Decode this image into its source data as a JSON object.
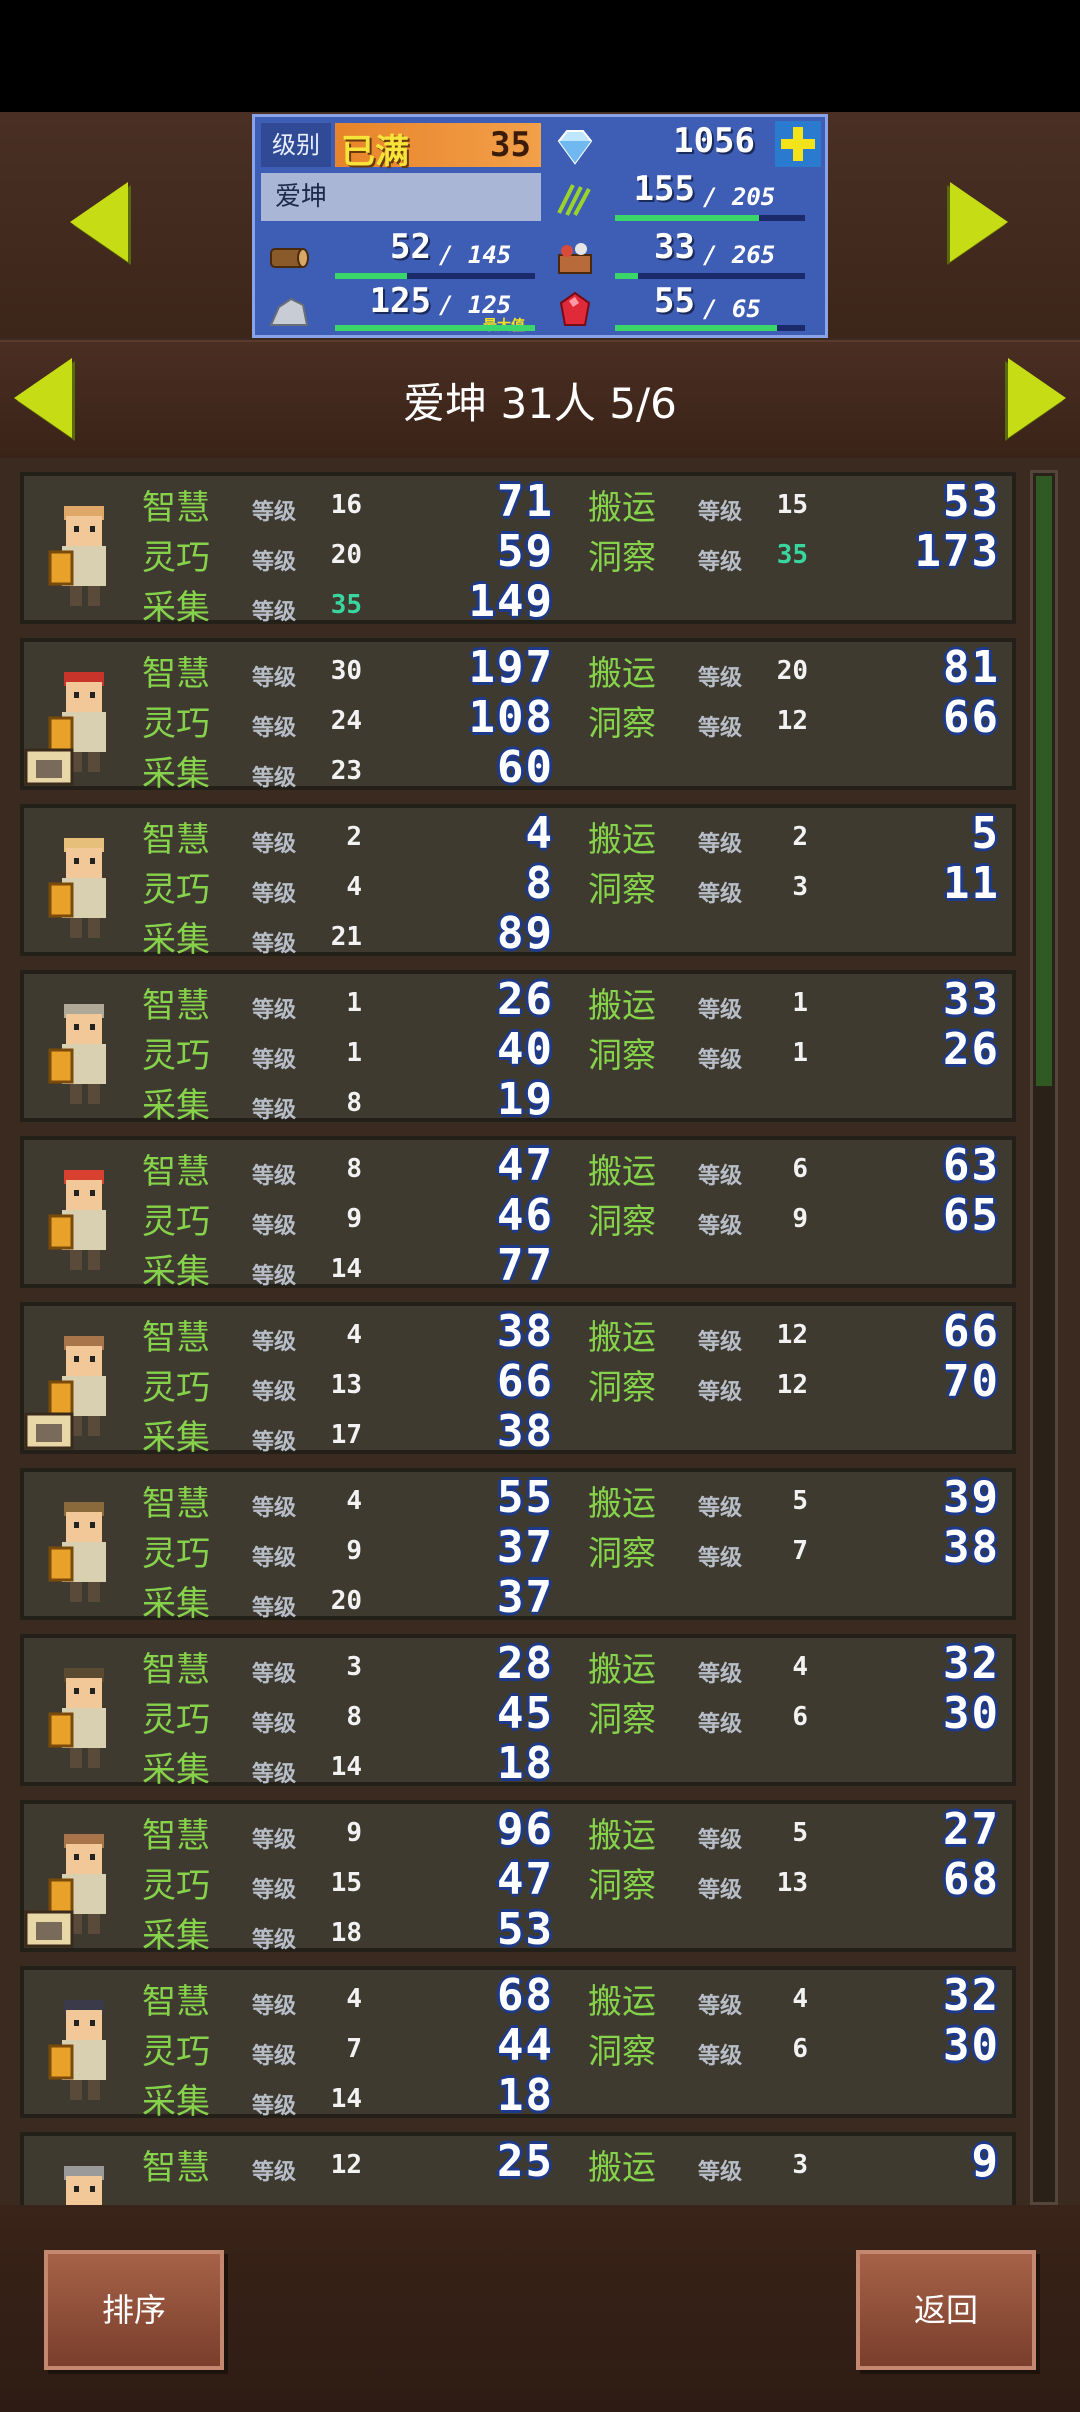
{
  "colors": {
    "accent_green": "#86d24a",
    "value_outline": "#1d3a8c",
    "panel_blue": "#3e5db4"
  },
  "status": {
    "rank_label": "级别",
    "rank_status": "已满",
    "rank_level": "35",
    "gems": "1056",
    "name": "爱坤",
    "resources": {
      "grass": {
        "value": "155",
        "max": "205",
        "icon": "grass-icon",
        "fill": 0.76
      },
      "wood": {
        "value": "52",
        "max": "145",
        "icon": "wood-log-icon",
        "fill": 0.36
      },
      "vegetables": {
        "value": "33",
        "max": "265",
        "icon": "vegetable-basket-icon",
        "fill": 0.12
      },
      "stone": {
        "value": "125",
        "max": "125",
        "max_label": "最大值",
        "icon": "stone-icon",
        "fill": 1.0
      },
      "ruby": {
        "value": "55",
        "max": "65",
        "icon": "ruby-icon",
        "fill": 0.85
      }
    }
  },
  "team": {
    "title": "爱坤  31人 5/6"
  },
  "labels": {
    "wisdom": "智慧",
    "dexterity": "灵巧",
    "gather": "采集",
    "carry": "搬运",
    "insight": "洞察",
    "level": "等级"
  },
  "members": [
    {
      "avatar": "blonde-worker-avatar",
      "wisdom": {
        "lv": "16",
        "val": "71"
      },
      "dexterity": {
        "lv": "20",
        "val": "59"
      },
      "gather": {
        "lv": "35",
        "val": "149",
        "hi": true
      },
      "carry": {
        "lv": "15",
        "val": "53"
      },
      "insight": {
        "lv": "35",
        "val": "173",
        "hi": true
      },
      "badge": null
    },
    {
      "avatar": "king-avatar",
      "wisdom": {
        "lv": "30",
        "val": "197"
      },
      "dexterity": {
        "lv": "24",
        "val": "108"
      },
      "gather": {
        "lv": "23",
        "val": "60"
      },
      "carry": {
        "lv": "20",
        "val": "81"
      },
      "insight": {
        "lv": "12",
        "val": "66"
      },
      "badge": "house-egg-icon"
    },
    {
      "avatar": "knight-avatar",
      "wisdom": {
        "lv": "2",
        "val": "4"
      },
      "dexterity": {
        "lv": "4",
        "val": "8"
      },
      "gather": {
        "lv": "21",
        "val": "89"
      },
      "carry": {
        "lv": "2",
        "val": "5"
      },
      "insight": {
        "lv": "3",
        "val": "11"
      },
      "badge": null
    },
    {
      "avatar": "hooded-worker-avatar",
      "wisdom": {
        "lv": "1",
        "val": "26"
      },
      "dexterity": {
        "lv": "1",
        "val": "40"
      },
      "gather": {
        "lv": "8",
        "val": "19"
      },
      "carry": {
        "lv": "1",
        "val": "33"
      },
      "insight": {
        "lv": "1",
        "val": "26"
      },
      "badge": null
    },
    {
      "avatar": "red-hat-worker-avatar",
      "wisdom": {
        "lv": "8",
        "val": "47"
      },
      "dexterity": {
        "lv": "9",
        "val": "46"
      },
      "gather": {
        "lv": "14",
        "val": "77"
      },
      "carry": {
        "lv": "6",
        "val": "63"
      },
      "insight": {
        "lv": "9",
        "val": "65"
      },
      "badge": null
    },
    {
      "avatar": "long-hair-worker-avatar",
      "wisdom": {
        "lv": "4",
        "val": "38"
      },
      "dexterity": {
        "lv": "13",
        "val": "66"
      },
      "gather": {
        "lv": "17",
        "val": "38"
      },
      "carry": {
        "lv": "12",
        "val": "66"
      },
      "insight": {
        "lv": "12",
        "val": "70"
      },
      "badge": "house-icon"
    },
    {
      "avatar": "brown-hair-worker-avatar",
      "wisdom": {
        "lv": "4",
        "val": "55"
      },
      "dexterity": {
        "lv": "9",
        "val": "37"
      },
      "gather": {
        "lv": "20",
        "val": "37"
      },
      "carry": {
        "lv": "5",
        "val": "39"
      },
      "insight": {
        "lv": "7",
        "val": "38"
      },
      "badge": null
    },
    {
      "avatar": "glasses-worker-avatar",
      "wisdom": {
        "lv": "3",
        "val": "28"
      },
      "dexterity": {
        "lv": "8",
        "val": "45"
      },
      "gather": {
        "lv": "14",
        "val": "18"
      },
      "carry": {
        "lv": "4",
        "val": "32"
      },
      "insight": {
        "lv": "6",
        "val": "30"
      },
      "badge": null
    },
    {
      "avatar": "ponytail-worker-avatar",
      "wisdom": {
        "lv": "9",
        "val": "96"
      },
      "dexterity": {
        "lv": "15",
        "val": "47"
      },
      "gather": {
        "lv": "18",
        "val": "53"
      },
      "carry": {
        "lv": "5",
        "val": "27"
      },
      "insight": {
        "lv": "13",
        "val": "68"
      },
      "badge": "house-icon"
    },
    {
      "avatar": "dark-hair-worker-avatar",
      "wisdom": {
        "lv": "4",
        "val": "68"
      },
      "dexterity": {
        "lv": "7",
        "val": "44"
      },
      "gather": {
        "lv": "14",
        "val": "18"
      },
      "carry": {
        "lv": "4",
        "val": "32"
      },
      "insight": {
        "lv": "6",
        "val": "30"
      },
      "badge": null
    },
    {
      "avatar": "grey-hair-worker-avatar",
      "wisdom": {
        "lv": "12",
        "val": "25"
      },
      "dexterity": null,
      "gather": null,
      "carry": {
        "lv": "3",
        "val": "9"
      },
      "insight": null,
      "badge": null
    }
  ],
  "buttons": {
    "sort": "排序",
    "back": "返回"
  }
}
